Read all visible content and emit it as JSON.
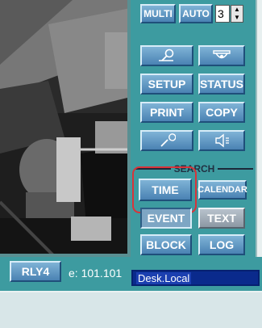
{
  "toolbar": {
    "multi_label": "MULTI",
    "auto_label": "AUTO",
    "spin_value": "3"
  },
  "buttons": {
    "setup": "SETUP",
    "status": "STATUS",
    "print": "PRINT",
    "copy": "COPY",
    "time": "TIME",
    "calendar": "CALENDAR",
    "event": "EVENT",
    "text": "TEXT",
    "block": "BLOCK",
    "log": "LOG",
    "rly4": "RLY4"
  },
  "search": {
    "label": "SEARCH"
  },
  "connection": {
    "ip_text": "e: 101.101",
    "site_selected": "Desk.Local"
  },
  "icons": {
    "camera_icon_1": "pen-zoom-icon",
    "camera_icon_2": "dome-camera-icon",
    "tool_icon": "pencil-icon",
    "audio_icon": "speaker-icon"
  },
  "colors": {
    "panel": "#3d9ba0",
    "button": "#5b8fc0",
    "highlight": "#d8343a",
    "dropdown": "#0a2a8c"
  }
}
